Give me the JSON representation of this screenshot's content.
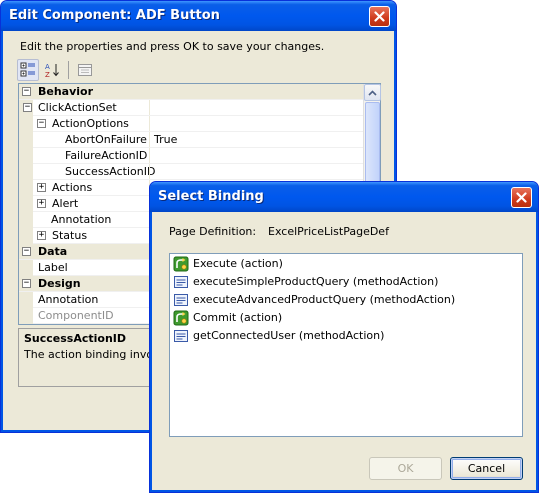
{
  "edit_dialog": {
    "title": "Edit Component: ADF Button",
    "instructions": "Edit the properties and press OK to save your changes.",
    "toolbar": {
      "categorized_icon": "categorized-icon",
      "alphabetical_icon": "alphabetical-sort-icon",
      "property_pages_icon": "property-pages-icon"
    },
    "grid": {
      "rows": [
        {
          "kind": "category",
          "name": "Behavior",
          "expander": "⊟"
        },
        {
          "kind": "property",
          "name": "ClickActionSet",
          "expander": "⊟",
          "value": ""
        },
        {
          "kind": "property",
          "name": "ActionOptions",
          "expander": "⊟",
          "value": ""
        },
        {
          "kind": "property",
          "name": "AbortOnFailure",
          "value": "True"
        },
        {
          "kind": "property",
          "name": "FailureActionID",
          "value": ""
        },
        {
          "kind": "property",
          "name": "SuccessActionID",
          "value": ""
        },
        {
          "kind": "property",
          "name": "Actions",
          "expander": "⊞",
          "value": ""
        },
        {
          "kind": "property",
          "name": "Alert",
          "expander": "⊞",
          "value": ""
        },
        {
          "kind": "property",
          "name": "Annotation",
          "value": ""
        },
        {
          "kind": "property",
          "name": "Status",
          "expander": "⊞",
          "value": ""
        },
        {
          "kind": "category",
          "name": "Data",
          "expander": "⊟"
        },
        {
          "kind": "property",
          "name": "Label",
          "value": ""
        },
        {
          "kind": "category",
          "name": "Design",
          "expander": "⊟"
        },
        {
          "kind": "property",
          "name": "Annotation",
          "value": ""
        },
        {
          "kind": "property",
          "name": "ComponentID",
          "value": ""
        }
      ]
    },
    "description": {
      "title": "SuccessActionID",
      "text": "The action binding invoked"
    }
  },
  "select_binding": {
    "title": "Select Binding",
    "page_definition_label": "Page Definition:",
    "page_definition_value": "ExcelPriceListPageDef",
    "items": [
      {
        "label": "Execute (action)",
        "icon": "action-icon"
      },
      {
        "label": "executeSimpleProductQuery  (methodAction)",
        "icon": "method-action-icon"
      },
      {
        "label": "executeAdvancedProductQuery  (methodAction)",
        "icon": "method-action-icon"
      },
      {
        "label": "Commit (action)",
        "icon": "action-icon"
      },
      {
        "label": "getConnectedUser (methodAction)",
        "icon": "method-action-icon"
      }
    ],
    "ok_label": "OK",
    "cancel_label": "Cancel"
  },
  "colors": {
    "title_bar": "#0054e3",
    "close_button": "#cf3a1b",
    "dialog_face": "#ece9d8"
  }
}
